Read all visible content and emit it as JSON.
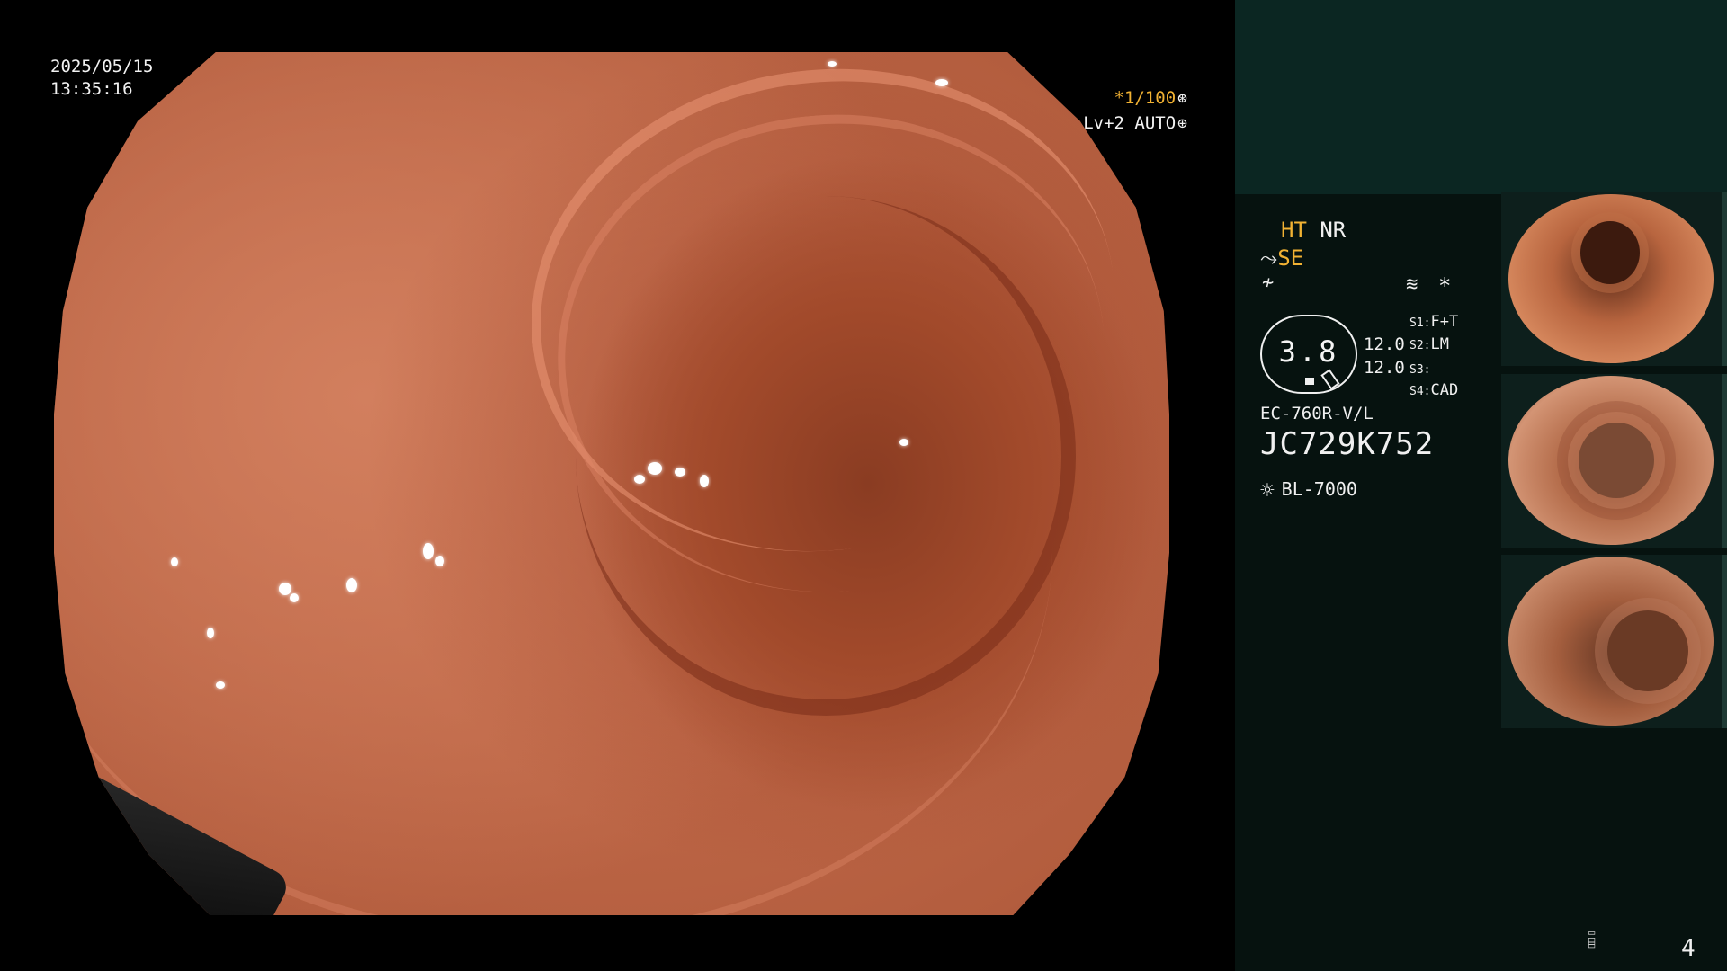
{
  "overlay": {
    "date": "2025/05/15",
    "time": "13:35:16",
    "shutter": "*1/100",
    "shutter_icon": "aperture-icon",
    "level": "Lv+2 AUTO",
    "level_icon": "iris-icon"
  },
  "panel": {
    "ht": "HT",
    "nr": "NR",
    "se": "SE",
    "se_icon": "enhancement-icon",
    "freeze_icon": "freeze-icon",
    "wave_icon": "structure-icon",
    "star": "*",
    "zoom": "3.8",
    "value_a": "12.0",
    "value_b": "12.0",
    "switches": [
      {
        "key": "S1:",
        "value": "F+T"
      },
      {
        "key": "S2:",
        "value": "LM"
      },
      {
        "key": "S3:",
        "value": ""
      },
      {
        "key": "S4:",
        "value": "CAD"
      }
    ],
    "scope_model": "EC-760R-V/L",
    "scope_serial": "JC729K752",
    "light_source": "BL-7000",
    "light_icon": "light-source-icon"
  },
  "page_number": "4",
  "colors": {
    "accent": "#f2b233",
    "panel_bg": "#06120f",
    "panel_top": "#0b2622",
    "mucosa": "#c8704f"
  }
}
